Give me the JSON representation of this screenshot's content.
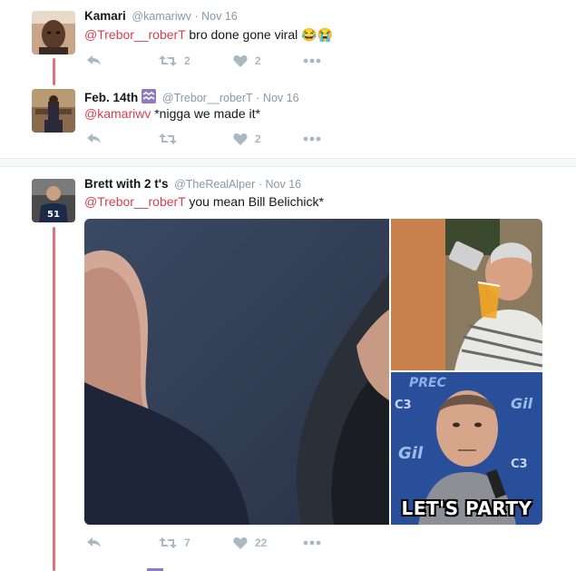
{
  "tweets": [
    {
      "name": "Kamari",
      "handle": "@kamariwv",
      "time": "· Nov 16",
      "mention": "@Trebor__roberT",
      "text": " bro done gone viral 😂😭",
      "retweets": "2",
      "likes": "2"
    },
    {
      "name": "Feb. 14th",
      "badge_icon": "aquarius-icon",
      "handle": "@Trebor__roberT",
      "time": "· Nov 16",
      "mention": "@kamariwv",
      "text": " *nigga we made it*",
      "retweets": "",
      "likes": "2"
    },
    {
      "name": "Brett with 2 t's",
      "handle": "@TheRealAlper",
      "time": "· Nov 16",
      "mention": "@Trebor__roberT",
      "text": " you mean Bill Belichick*",
      "retweets": "7",
      "likes": "22",
      "media_caption": "LET'S PARTY"
    }
  ],
  "colors": {
    "mention": "#d6404c",
    "thread_line": "#e0727a",
    "meta": "#8899a6",
    "action": "#aab8c2"
  },
  "icons": [
    "reply-icon",
    "retweet-icon",
    "heart-icon",
    "more-icon"
  ]
}
